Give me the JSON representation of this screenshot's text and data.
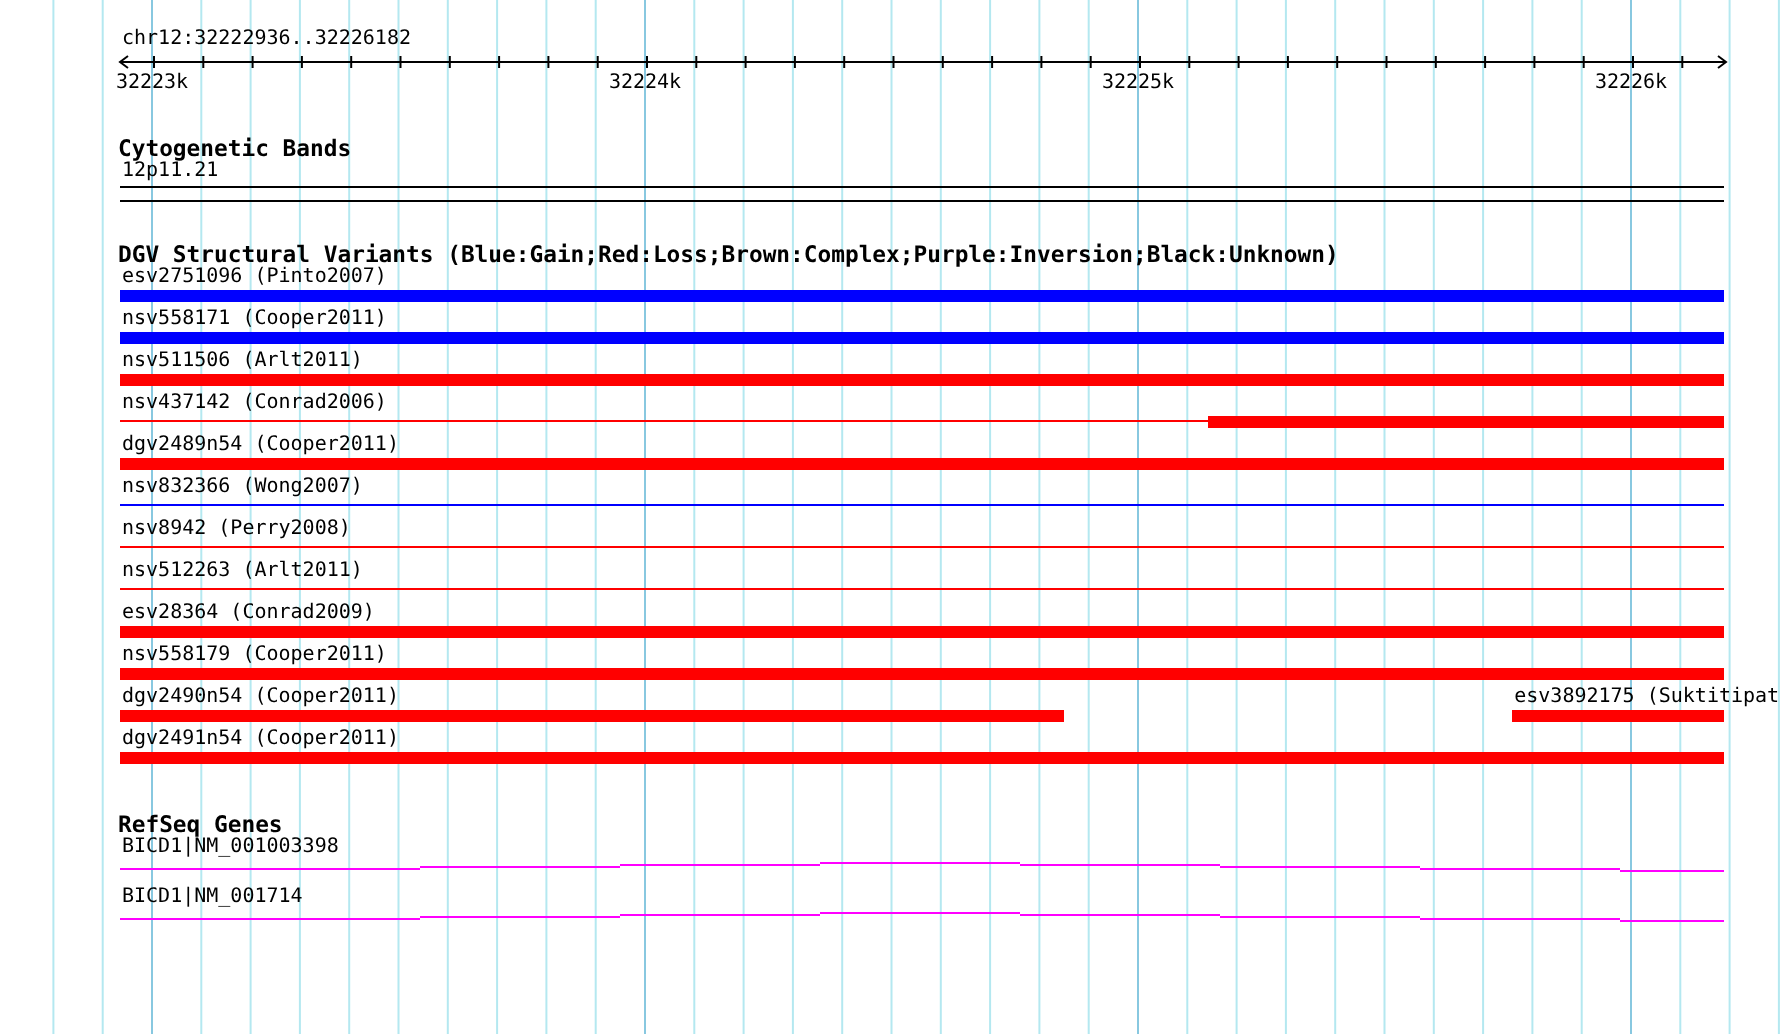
{
  "ruler": {
    "position": "chr12:32222936..32226182",
    "ticks": [
      "32223k",
      "32224k",
      "32225k",
      "32226k"
    ]
  },
  "cytogenetic_bands": {
    "title": "Cytogenetic Bands",
    "band": "12p11.21"
  },
  "structural_variants": {
    "title": "DGV Structural Variants (Blue:Gain;Red:Loss;Brown:Complex;Purple:Inversion;Black:Unknown)",
    "rows": [
      {
        "features": [
          {
            "label": "esv2751096 (Pinto2007)",
            "kind": "full-bar",
            "color": "#0000ff"
          }
        ]
      },
      {
        "features": [
          {
            "label": "nsv558171 (Cooper2011)",
            "kind": "full-bar",
            "color": "#0000ff"
          }
        ]
      },
      {
        "features": [
          {
            "label": "nsv511506 (Arlt2011)",
            "kind": "full-bar",
            "color": "#ff0000"
          }
        ]
      },
      {
        "features": [
          {
            "label": "nsv437142 (Conrad2006)",
            "kind": "full-line",
            "color": "#ff0000"
          },
          {
            "kind": "right-bar",
            "color": "#ff0000"
          }
        ]
      },
      {
        "features": [
          {
            "label": "dgv2489n54 (Cooper2011)",
            "kind": "full-bar",
            "color": "#ff0000"
          }
        ]
      },
      {
        "features": [
          {
            "label": "nsv832366 (Wong2007)",
            "kind": "full-line",
            "color": "#0000ff"
          }
        ]
      },
      {
        "features": [
          {
            "label": "nsv8942 (Perry2008)",
            "kind": "full-line",
            "color": "#ff0000"
          }
        ]
      },
      {
        "features": [
          {
            "label": "nsv512263 (Arlt2011)",
            "kind": "full-line",
            "color": "#ff0000"
          }
        ]
      },
      {
        "features": [
          {
            "label": "esv28364 (Conrad2009)",
            "kind": "full-bar",
            "color": "#ff0000"
          }
        ]
      },
      {
        "features": [
          {
            "label": "nsv558179 (Cooper2011)",
            "kind": "full-bar",
            "color": "#ff0000"
          }
        ]
      },
      {
        "features": [
          {
            "label": "dgv2490n54 (Cooper2011)",
            "kind": "left-bar",
            "color": "#ff0000"
          },
          {
            "label": "esv3892175 (Suktitipat",
            "kind": "far-right-bar",
            "color": "#ff0000"
          }
        ]
      },
      {
        "features": [
          {
            "label": "dgv2491n54 (Cooper2011)",
            "kind": "full-bar",
            "color": "#ff0000"
          }
        ]
      }
    ]
  },
  "refseq_genes": {
    "title": "RefSeq Genes",
    "genes": [
      {
        "label": "BICD1|NM_001003398"
      },
      {
        "label": "BICD1|NM_001714"
      }
    ]
  }
}
